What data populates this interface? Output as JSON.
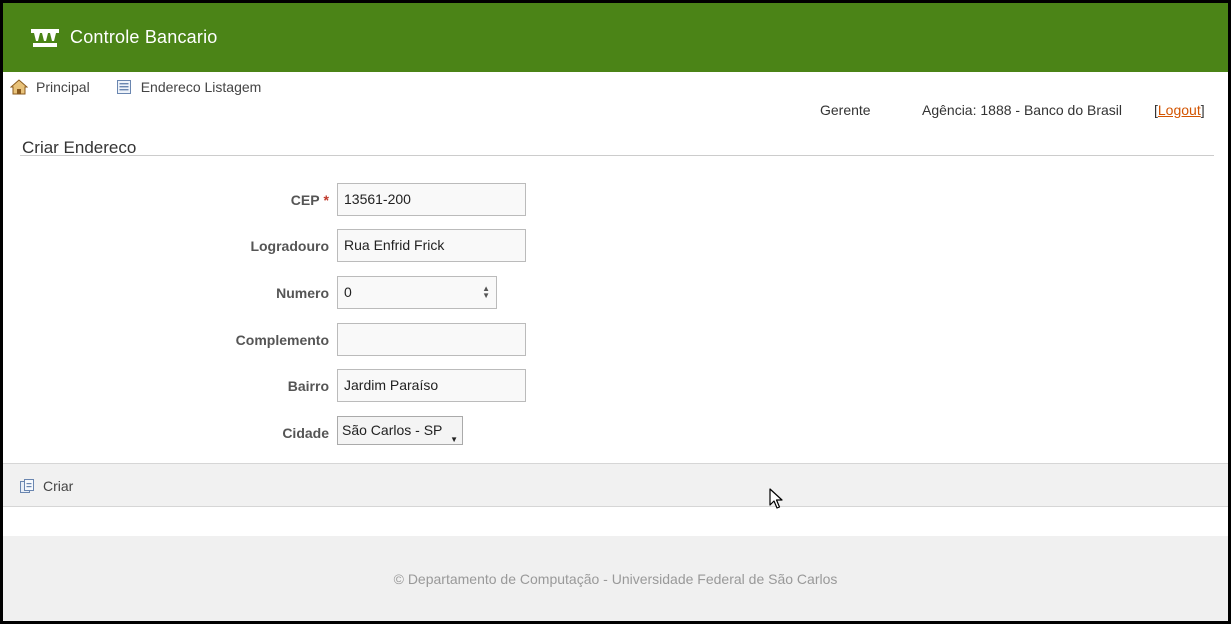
{
  "header": {
    "title": "Controle Bancario",
    "icon": "bank-icon",
    "background": "#4b8417"
  },
  "nav": [
    {
      "label": "Principal",
      "icon": "home-icon"
    },
    {
      "label": "Endereco Listagem",
      "icon": "list-icon"
    }
  ],
  "user": {
    "role": "Gerente",
    "agency": "Agência: 1888 - Banco do Brasil",
    "logout_open": "[",
    "logout_label": "Logout",
    "logout_close": "]"
  },
  "page": {
    "title": "Criar Endereco"
  },
  "form": {
    "cep": {
      "label": "CEP",
      "required_mark": "*",
      "value": "13561-200"
    },
    "logradouro": {
      "label": "Logradouro",
      "value": "Rua Enfrid Frick"
    },
    "numero": {
      "label": "Numero",
      "value": "0"
    },
    "complemento": {
      "label": "Complemento",
      "value": ""
    },
    "bairro": {
      "label": "Bairro",
      "value": "Jardim Paraíso"
    },
    "cidade": {
      "label": "Cidade",
      "value": "São Carlos - SP"
    }
  },
  "actions": {
    "create_label": "Criar",
    "create_icon": "create-icon"
  },
  "footer": {
    "text": "© Departamento de Computação - Universidade Federal de São Carlos"
  }
}
